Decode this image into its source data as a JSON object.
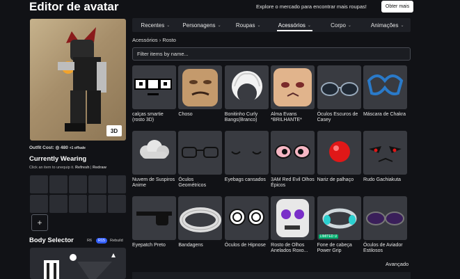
{
  "header": {
    "title": "Editor de avatar",
    "promo_text": "Explore o mercado para encontrar mais roupas!",
    "get_more_label": "Obter mais"
  },
  "avatar": {
    "view_3d_label": "3D",
    "outfit_cost_label": "Outfit Cost:",
    "outfit_cost_value": "480",
    "outfit_cost_suffix": "+1 offsale"
  },
  "currently_wearing": {
    "title": "Currently Wearing",
    "hint": "Click an item to unequip it.",
    "refresh_label": "Refresh",
    "redraw_label": "Redraw",
    "add_label": "+"
  },
  "body_selector": {
    "title": "Body Selector",
    "r6_label": "R6",
    "r15_label": "R15",
    "rebuild_label": "Rebuild"
  },
  "tabs": [
    {
      "label": "Recentes"
    },
    {
      "label": "Personagens"
    },
    {
      "label": "Roupas"
    },
    {
      "label": "Acessórios"
    },
    {
      "label": "Corpo"
    },
    {
      "label": "Animações"
    }
  ],
  "active_tab": "Acessórios",
  "breadcrumb": {
    "parent": "Acessórios",
    "current": "Rosto"
  },
  "filter": {
    "placeholder": "Filter items by name..."
  },
  "items": [
    {
      "name": "calças smartie (rosto 3D)"
    },
    {
      "name": "Choso"
    },
    {
      "name": "Bonitinho Curly Bangs(Branco)"
    },
    {
      "name": "Alma Evans *BRILHANTE*"
    },
    {
      "name": "Óculos Escuros de Casey"
    },
    {
      "name": "Máscara de Chakra"
    },
    {
      "name": "Nuvem de Suspiros Anime"
    },
    {
      "name": "Óculos Geométricos"
    },
    {
      "name": "Eyebags cansados"
    },
    {
      "name": "3AM Red Evil Olhos Épicos"
    },
    {
      "name": "Nariz de palhaço"
    },
    {
      "name": "Rudo Gachiakuta"
    },
    {
      "name": "Eyepatch Preto"
    },
    {
      "name": "Bandagens"
    },
    {
      "name": "Óculos de Hipnose"
    },
    {
      "name": "Rosto de Olhos Anelados Roxo..."
    },
    {
      "name": "Fone de cabeça Power Grip",
      "badge": "LIMITED U"
    },
    {
      "name": "Óculos de Aviador Estilosos"
    }
  ],
  "advanced_label": "Avançado",
  "colors": {
    "background": "#111216",
    "accent": "#335fff",
    "limited": "#00b06f"
  }
}
